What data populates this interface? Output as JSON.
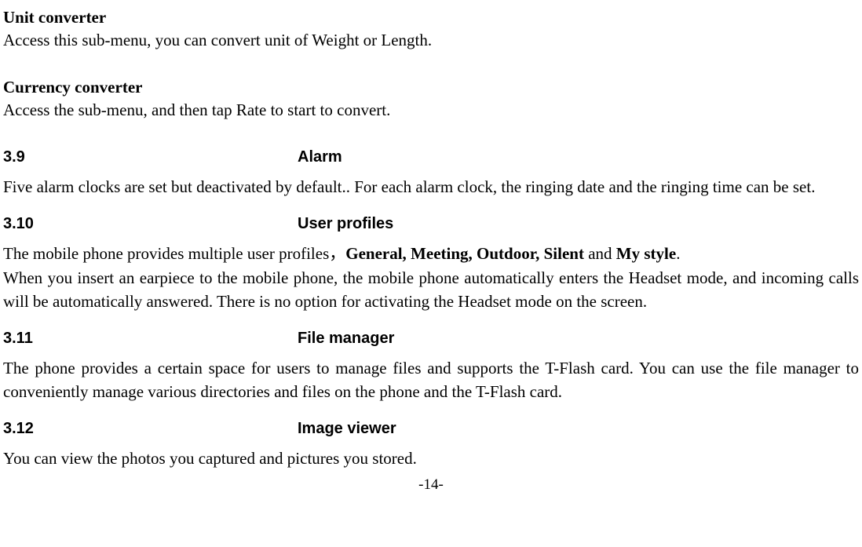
{
  "unit_converter": {
    "heading": "Unit converter",
    "body": "Access this sub-menu, you can convert unit of Weight or Length."
  },
  "currency_converter": {
    "heading": "Currency converter",
    "body": "Access the sub-menu, and then tap Rate to start to convert."
  },
  "sections": {
    "alarm": {
      "num": "3.9",
      "title": "Alarm",
      "body": "Five alarm clocks are set but deactivated by default.. For each alarm clock, the ringing date and the ringing time can be set."
    },
    "user_profiles": {
      "num": "3.10",
      "title": "User profiles",
      "line1_pre": "The mobile phone provides multiple user profiles，",
      "line1_bold1": "General, Meeting, Outdoor, Silent ",
      "line1_mid": "and ",
      "line1_bold2": "My style",
      "line1_post": ".",
      "line2": "When you insert an earpiece to the mobile phone, the mobile phone automatically enters the Headset mode, and incoming calls will be automatically answered. There is no option for activating the Headset mode on the screen."
    },
    "file_manager": {
      "num": "3.11",
      "title": "File manager",
      "body": "The phone provides a certain space for users to manage files and supports the T-Flash card. You can use the file manager to conveniently manage various directories and files on the phone and the T-Flash card."
    },
    "image_viewer": {
      "num": "3.12",
      "title": "Image viewer",
      "body": "You can view the photos you captured and pictures you stored."
    }
  },
  "footer": "-14-"
}
